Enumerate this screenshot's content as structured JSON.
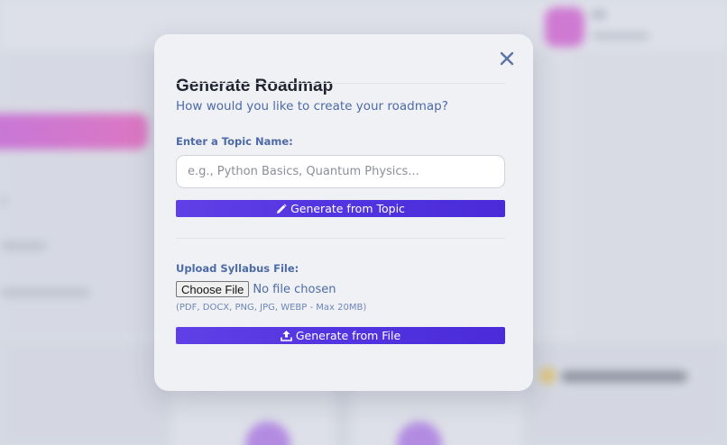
{
  "modal": {
    "title": "Generate Roadmap",
    "close_icon": "close-icon",
    "prompt": "How would you like to create your roadmap?",
    "topic": {
      "label": "Enter a Topic Name:",
      "placeholder": "e.g., Python Basics, Quantum Physics...",
      "value": "",
      "button_label": "Generate from Topic",
      "button_icon": "pencil-icon"
    },
    "upload": {
      "label": "Upload Syllabus File:",
      "choose_button": "Choose File",
      "status": "No file chosen",
      "hint": "(PDF, DOCX, PNG, JPG, WEBP - Max 20MB)",
      "button_label": "Generate from File",
      "button_icon": "upload-icon"
    }
  },
  "colors": {
    "accent": "#5234e0",
    "label_text": "#4d6aa8",
    "title_text": "#1f2430",
    "modal_bg": "#f0f1f4"
  }
}
